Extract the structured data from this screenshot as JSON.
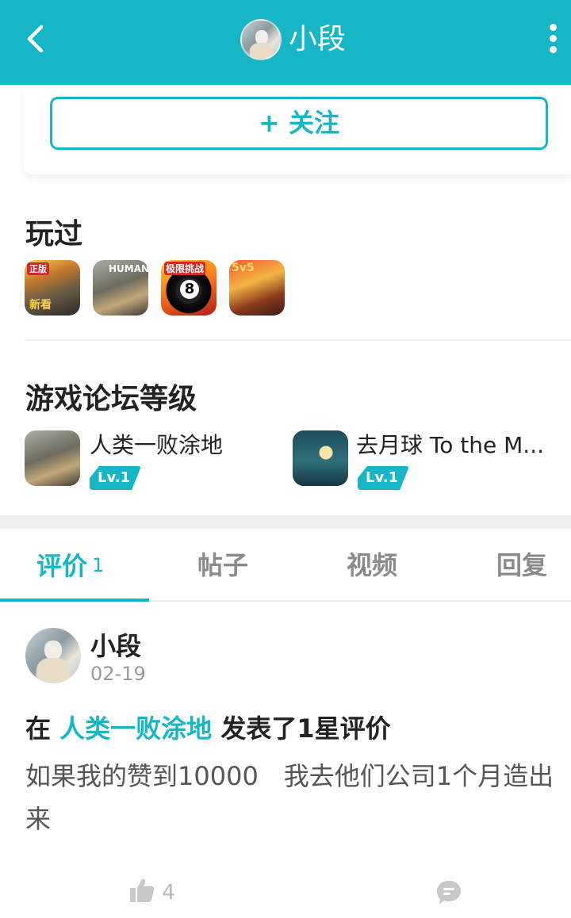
{
  "header": {
    "title": "小段",
    "back_icon": "chevron-left-icon",
    "more_icon": "more-vertical-icon",
    "bg_color": "#17b6c6"
  },
  "follow": {
    "label": "+ 关注"
  },
  "played": {
    "title": "玩过",
    "games": [
      {
        "icon": "pubg-game-icon",
        "tag_top": "正版",
        "tag_bottom": "新看"
      },
      {
        "icon": "human-fall-flat-game-icon",
        "tag_top": "HUMAN"
      },
      {
        "icon": "8-ball-game-icon",
        "tag_top": "极限挑战",
        "ball": "8"
      },
      {
        "icon": "honor-of-kings-game-icon",
        "tag_top": "5v5"
      }
    ]
  },
  "forum_level": {
    "title": "游戏论坛等级",
    "items": [
      {
        "name": "人类一败涂地",
        "level": "Lv.1"
      },
      {
        "name": "去月球 To the M...",
        "level": "Lv.1"
      }
    ]
  },
  "tabs": [
    {
      "label": "评价",
      "count": "1"
    },
    {
      "label": "帖子"
    },
    {
      "label": "视频"
    },
    {
      "label": "回复"
    }
  ],
  "post": {
    "author": "小段",
    "date": "02-19",
    "prefix": "在",
    "game": "人类一败涂地",
    "suffix": "发表了1星评价",
    "content": "如果我的赞到10000　我去他们公司1个月造出来",
    "likes": "4"
  },
  "colors": {
    "accent": "#17b6c6"
  }
}
